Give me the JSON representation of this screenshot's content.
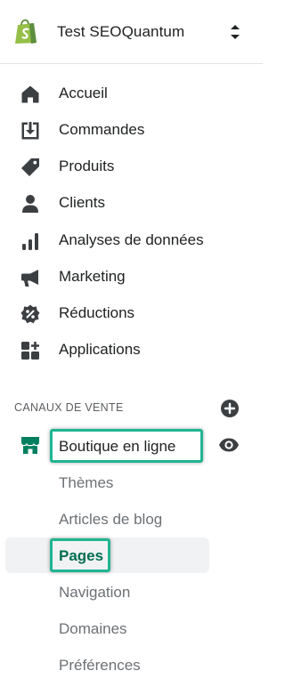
{
  "store": {
    "name": "Test SEOQuantum",
    "logo_icon": "shopify-bag-icon",
    "switch_icon": "chevron-up-down-icon",
    "brand_color": "#95bf47"
  },
  "nav": {
    "items": [
      {
        "label": "Accueil",
        "icon": "home-icon"
      },
      {
        "label": "Commandes",
        "icon": "orders-inbox-icon"
      },
      {
        "label": "Produits",
        "icon": "tag-icon"
      },
      {
        "label": "Clients",
        "icon": "person-icon"
      },
      {
        "label": "Analyses de données",
        "icon": "bar-chart-icon"
      },
      {
        "label": "Marketing",
        "icon": "megaphone-icon"
      },
      {
        "label": "Réductions",
        "icon": "discount-badge-icon"
      },
      {
        "label": "Applications",
        "icon": "apps-grid-icon"
      }
    ]
  },
  "sales_channels": {
    "title": "CANAUX DE VENTE",
    "add_icon": "plus-circle-icon",
    "online_store": {
      "label": "Boutique en ligne",
      "icon": "storefront-icon",
      "view_icon": "eye-icon"
    },
    "sub_items": [
      {
        "label": "Thèmes",
        "active": false
      },
      {
        "label": "Articles de blog",
        "active": false
      },
      {
        "label": "Pages",
        "active": true
      },
      {
        "label": "Navigation",
        "active": false
      },
      {
        "label": "Domaines",
        "active": false
      },
      {
        "label": "Préférences",
        "active": false
      }
    ]
  },
  "colors": {
    "highlight_border": "#1fb591",
    "active_text": "#006e52",
    "icon": "#3c3f42",
    "storefront_icon": "#007f5f"
  }
}
